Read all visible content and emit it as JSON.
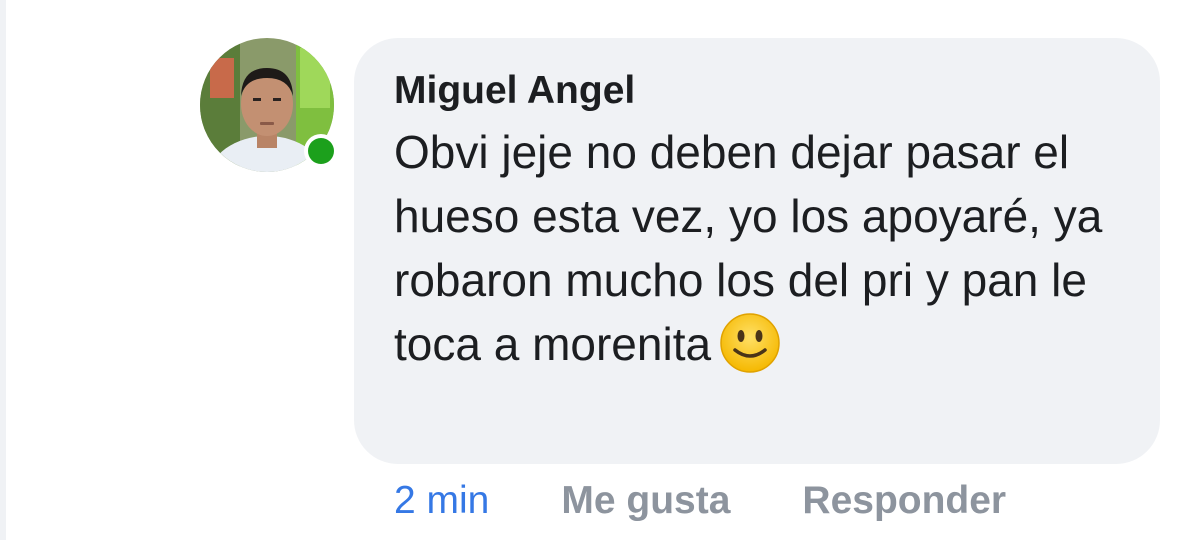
{
  "comment": {
    "author": "Miguel Angel",
    "text": "Obvi jeje no deben dejar pasar el hueso esta vez, yo los apoyaré, ya robaron mucho los del pri y pan le toca a morenita",
    "emoji": "slightly-smiling-face",
    "online_status_color": "#1ca01c"
  },
  "actions": {
    "timestamp": "2 min",
    "like_label": "Me gusta",
    "reply_label": "Responder"
  },
  "colors": {
    "bubble_bg": "#f0f2f5",
    "text": "#1c1e21",
    "timestamp": "#3578e5",
    "action": "#8d949e"
  }
}
